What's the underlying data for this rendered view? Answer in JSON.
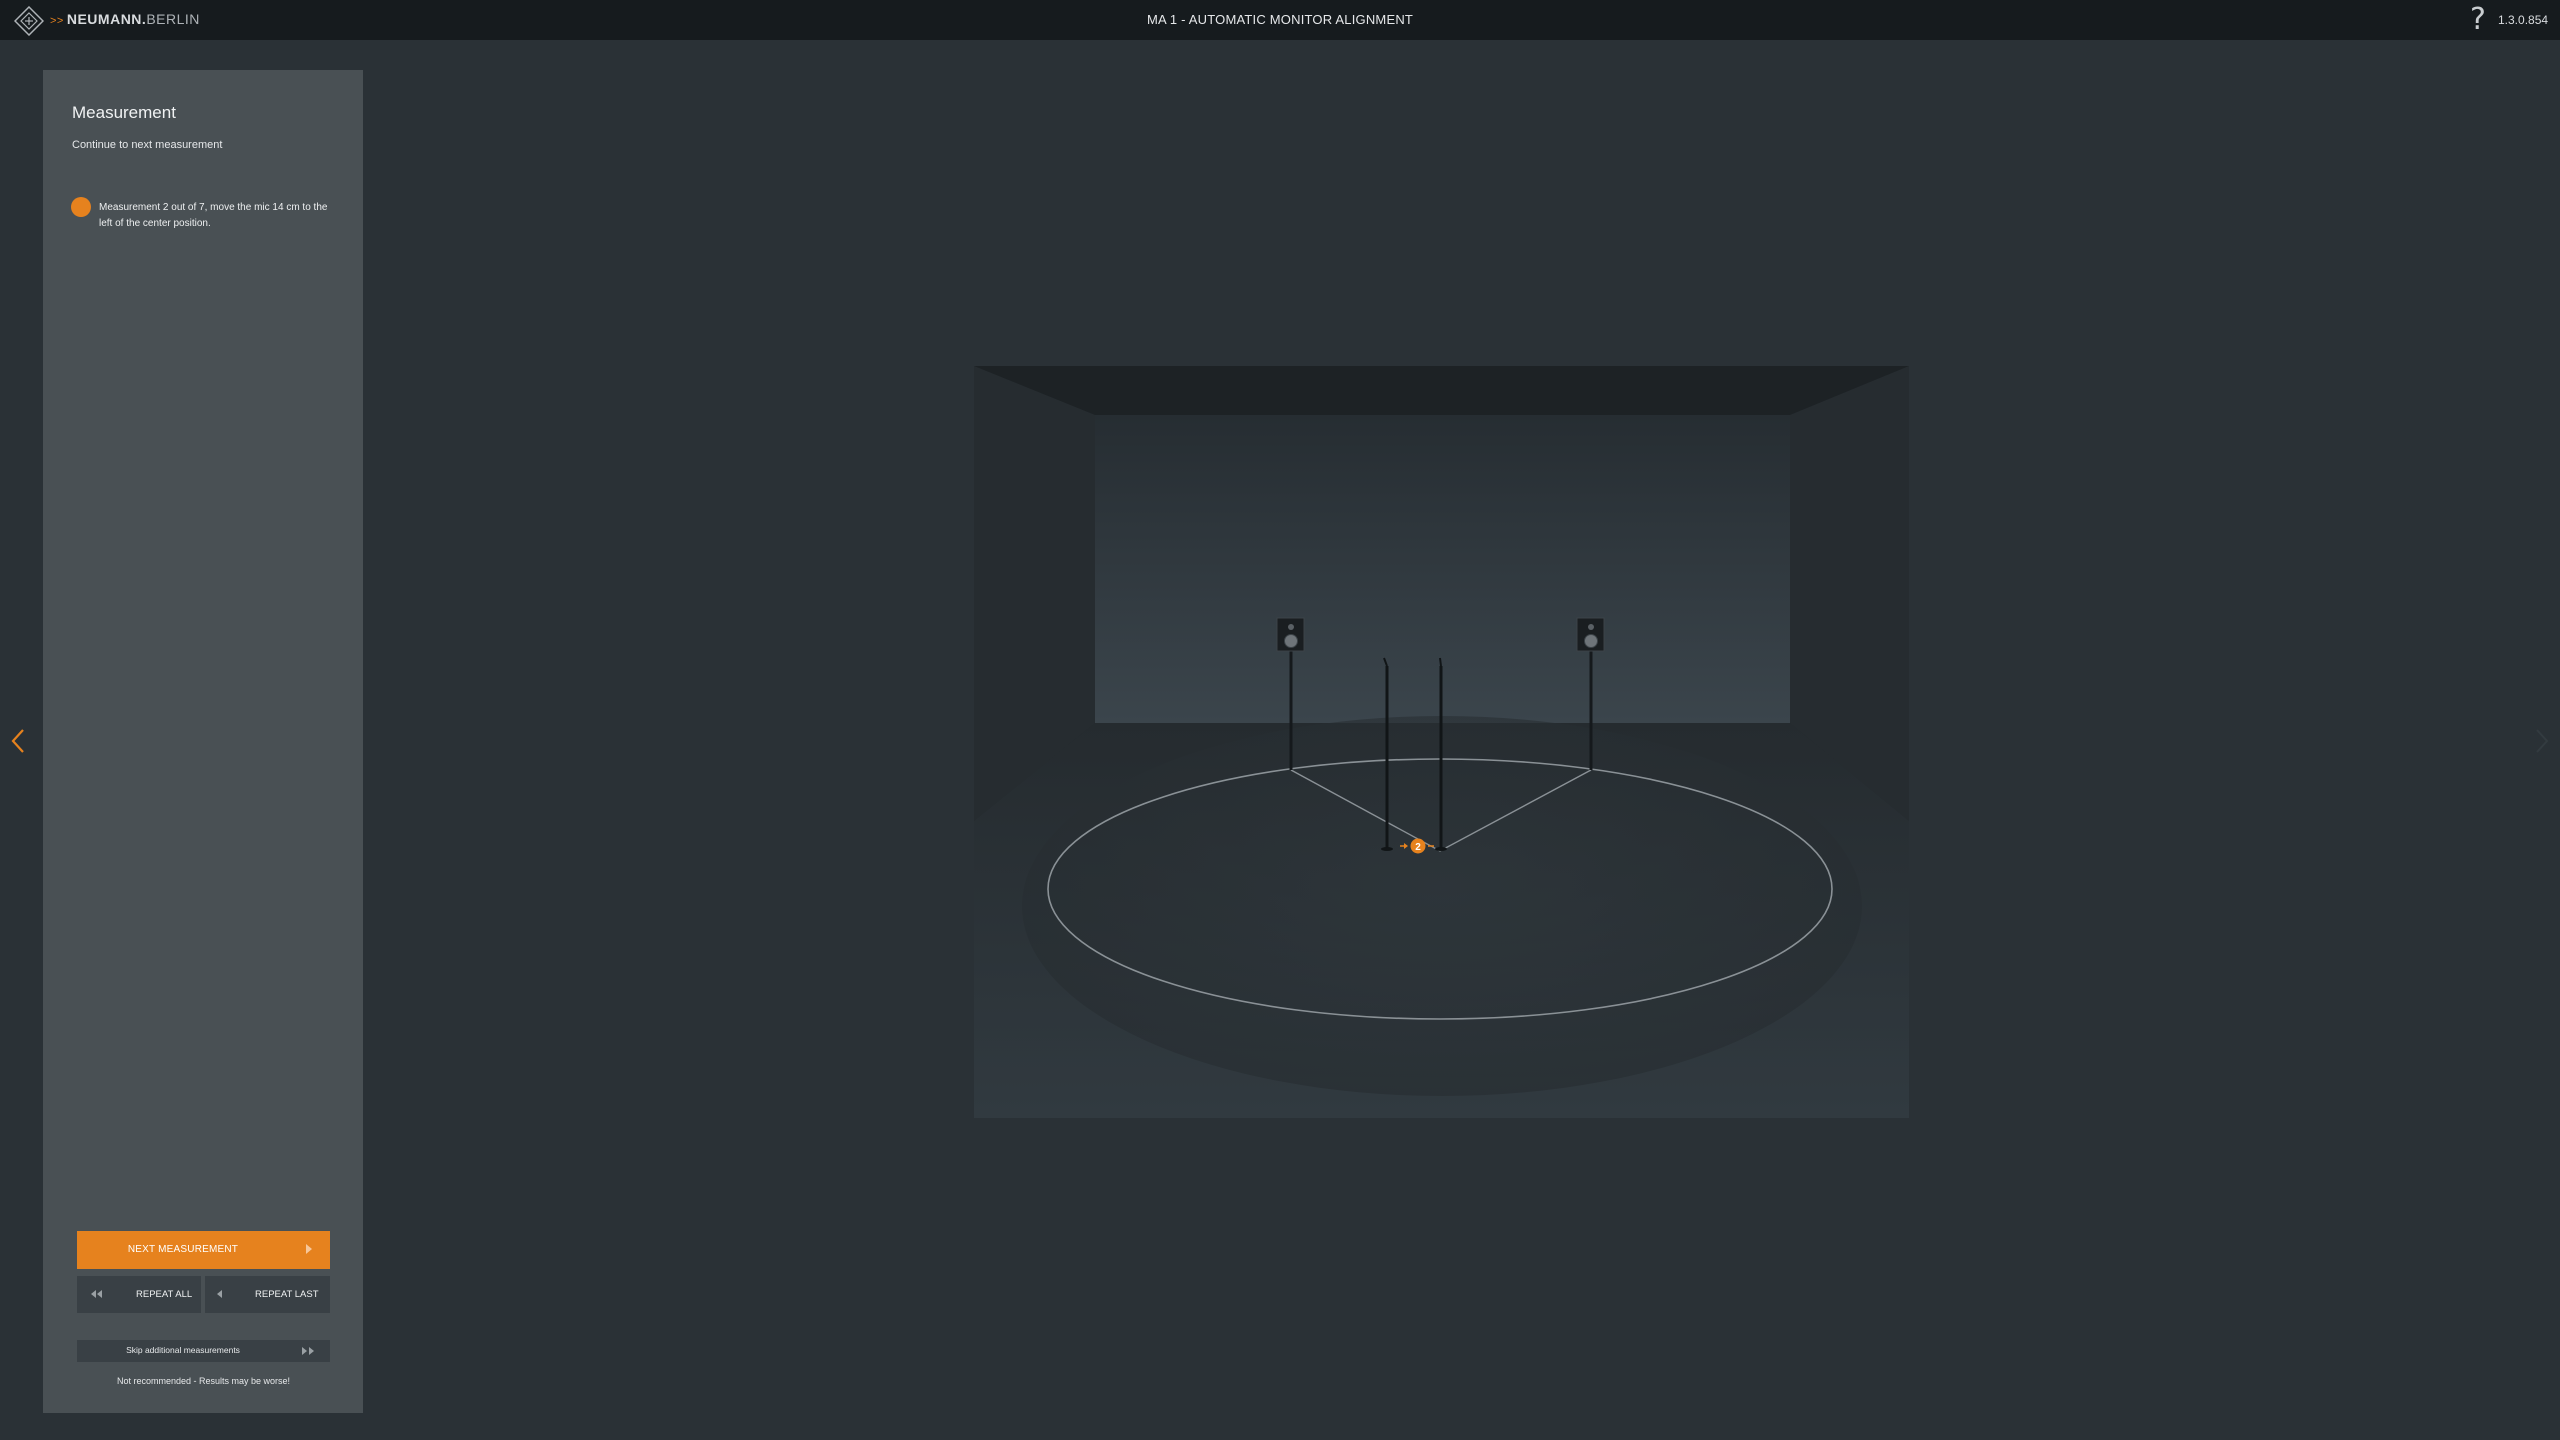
{
  "header": {
    "brand_primary": "NEUMANN.",
    "brand_secondary": "BERLIN",
    "title": "MA 1 - AUTOMATIC MONITOR ALIGNMENT",
    "help_label": "?",
    "version": "1.3.0.854"
  },
  "panel": {
    "title": "Measurement",
    "subtitle": "Continue to next measurement",
    "status_text": "Measurement 2 out of 7, move the mic 14 cm to the left of the center position.",
    "next_label": "NEXT MEASUREMENT",
    "repeat_all_label": "REPEAT ALL",
    "repeat_last_label": "REPEAT LAST",
    "skip_label": "Skip additional measurements",
    "warning": "Not recommended - Results may be worse!"
  },
  "scene": {
    "mic_position_number": "2"
  },
  "colors": {
    "accent": "#e6821e",
    "background": "#2a3136",
    "panel": "#495054",
    "topbar": "#161b1e",
    "button_dark": "#394045"
  },
  "icons": {
    "logo": "neumann-diamond-logo",
    "help": "question-mark-icon",
    "nav_left": "chevron-left-icon",
    "nav_right": "chevron-right-icon",
    "next": "play-arrow-icon",
    "repeat_all": "rewind-icon",
    "repeat_last": "back-arrow-icon",
    "skip": "fast-forward-icon"
  }
}
